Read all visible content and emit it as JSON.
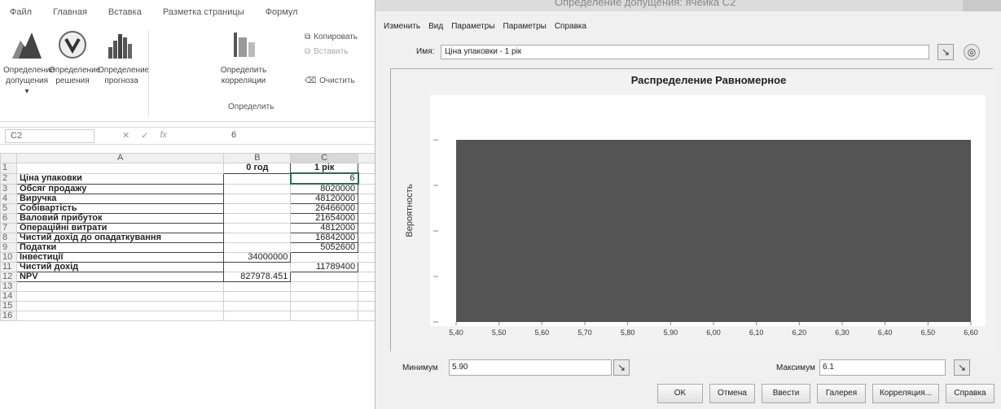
{
  "excel": {
    "menu": [
      "Файл",
      "Главная",
      "Вставка",
      "Разметка страницы",
      "Формул"
    ],
    "ribbon": {
      "buttons": [
        {
          "label": "Определение допущения ▾",
          "icon": "mountain-chart-icon"
        },
        {
          "label": "Определение решения",
          "icon": "decision-icon"
        },
        {
          "label": "Определение прогноза",
          "icon": "forecast-bar-icon"
        },
        {
          "label": "Определить корреляции",
          "icon": "correlation-icon"
        }
      ],
      "small": [
        "Копировать",
        "Вставить",
        "Очистить"
      ],
      "group_label": "Определить"
    },
    "namebox": "C2",
    "formula": "6",
    "columns": [
      "A",
      "B",
      "C"
    ],
    "rows": [
      {
        "n": "1",
        "a": "",
        "b": "0 год",
        "c": "1 рік"
      },
      {
        "n": "2",
        "a": "Ціна упаковки",
        "b": "",
        "c": "6"
      },
      {
        "n": "3",
        "a": "Обсяг продажу",
        "b": "",
        "c": "8020000"
      },
      {
        "n": "4",
        "a": "Виручка",
        "b": "",
        "c": "48120000"
      },
      {
        "n": "5",
        "a": "Собівартість",
        "b": "",
        "c": "26466000"
      },
      {
        "n": "6",
        "a": "Валовий прибуток",
        "b": "",
        "c": "21654000"
      },
      {
        "n": "7",
        "a": "Операційні витрати",
        "b": "",
        "c": "4812000"
      },
      {
        "n": "8",
        "a": "Чистий дохід до опадаткування",
        "b": "",
        "c": "16842000"
      },
      {
        "n": "9",
        "a": "Податки",
        "b": "",
        "c": "5052600"
      },
      {
        "n": "10",
        "a": "Інвестиції",
        "b": "34000000",
        "c": ""
      },
      {
        "n": "11",
        "a": "Чистий дохід",
        "b": "",
        "c": "11789400"
      },
      {
        "n": "12",
        "a": "NPV",
        "b": "827978.451",
        "c": ""
      },
      {
        "n": "13",
        "a": "",
        "b": "",
        "c": ""
      },
      {
        "n": "14",
        "a": "",
        "b": "",
        "c": ""
      },
      {
        "n": "15",
        "a": "",
        "b": "",
        "c": ""
      },
      {
        "n": "16",
        "a": "",
        "b": "",
        "c": ""
      }
    ]
  },
  "dialog": {
    "title": "Определение допущения: ячейка C2",
    "menu": [
      "Изменить",
      "Вид",
      "Параметры",
      "Параметры",
      "Справка"
    ],
    "name_label": "Имя:",
    "name_value": "Ціна упаковки - 1 рік",
    "min_label": "Минимум",
    "min_value": "5.90",
    "max_label": "Максимум",
    "max_value": "6.1",
    "buttons": [
      "OK",
      "Отмена",
      "Ввести",
      "Галерея",
      "Корреляция...",
      "Справка"
    ]
  },
  "chart_data": {
    "type": "area",
    "title": "Распределение Равномерное",
    "ylabel": "Вероятность",
    "xlabel": "",
    "x_ticks": [
      "5,40",
      "5,50",
      "5,60",
      "5,70",
      "5,80",
      "5,90",
      "6,00",
      "6,10",
      "6,20",
      "6,30",
      "6,40",
      "6,50",
      "6,60"
    ],
    "xlim": [
      5.4,
      6.6
    ],
    "y_ticks_count": 5,
    "series": [
      {
        "x": [
          5.4,
          6.6
        ],
        "y": [
          1,
          1
        ]
      }
    ],
    "fill": "#545454"
  }
}
